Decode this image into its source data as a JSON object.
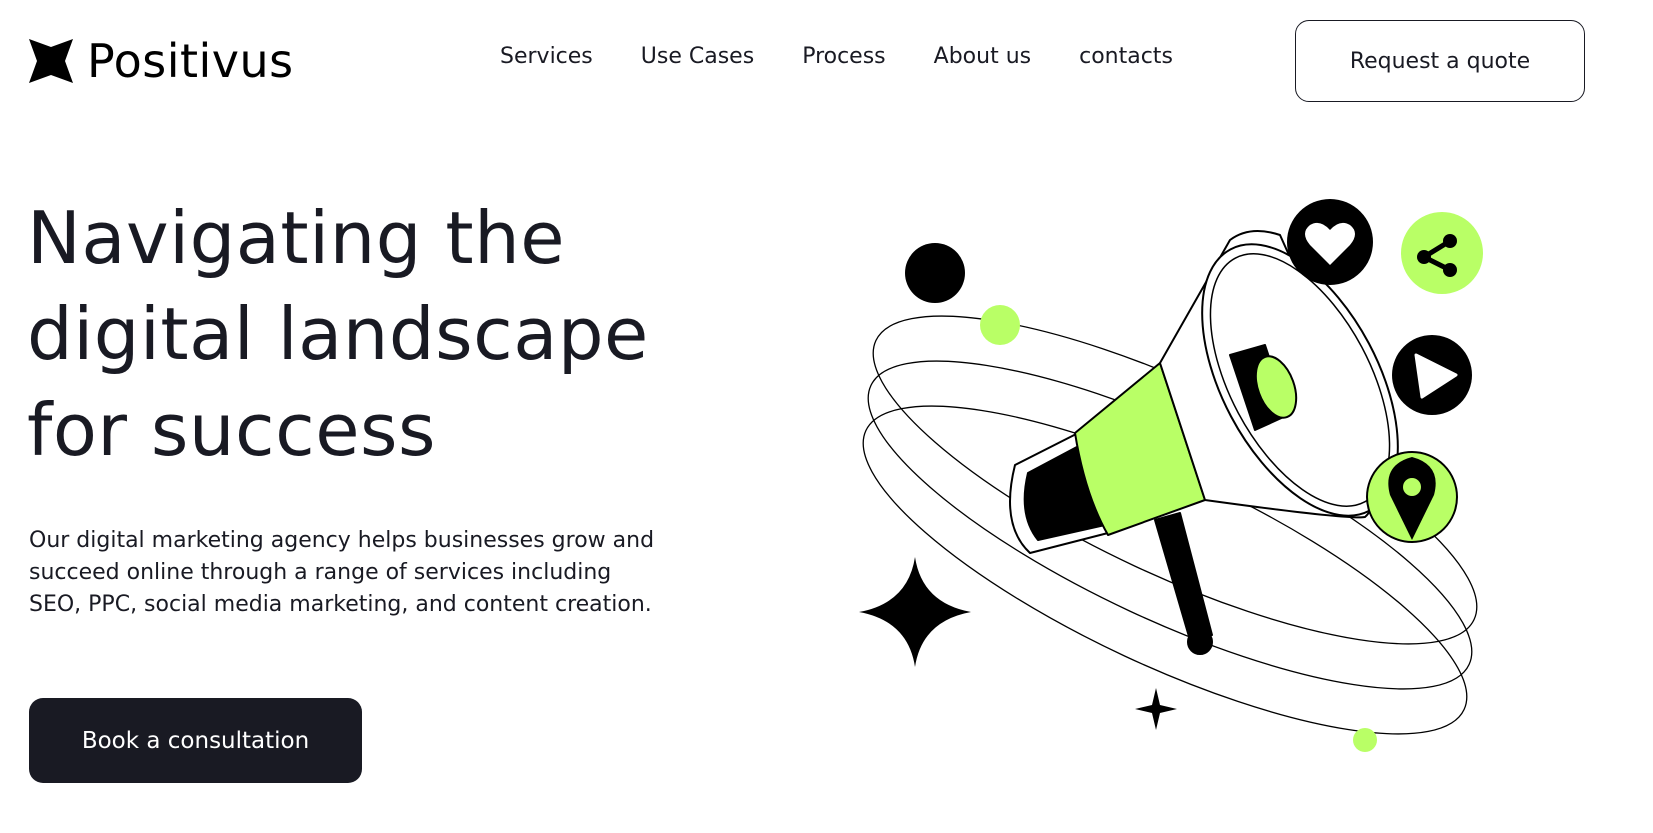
{
  "brand": {
    "name": "Positivus",
    "accent_color": "#B9FF66",
    "dark_color": "#191A23"
  },
  "nav": {
    "items": [
      {
        "label": "Services"
      },
      {
        "label": "Use Cases"
      },
      {
        "label": "Process"
      },
      {
        "label": "About us"
      },
      {
        "label": "contacts"
      }
    ],
    "cta_label": "Request a quote"
  },
  "hero": {
    "title_lines": [
      "Navigating the",
      "digital landscape",
      "for success"
    ],
    "description": "Our digital marketing agency helps businesses grow and succeed online through a range of services including SEO, PPC, social media marketing, and content creation.",
    "cta_label": "Book a consultation"
  },
  "illustration": {
    "icons": [
      "megaphone-icon",
      "heart-icon",
      "share-icon",
      "play-icon",
      "location-pin-icon",
      "star-icon"
    ]
  }
}
